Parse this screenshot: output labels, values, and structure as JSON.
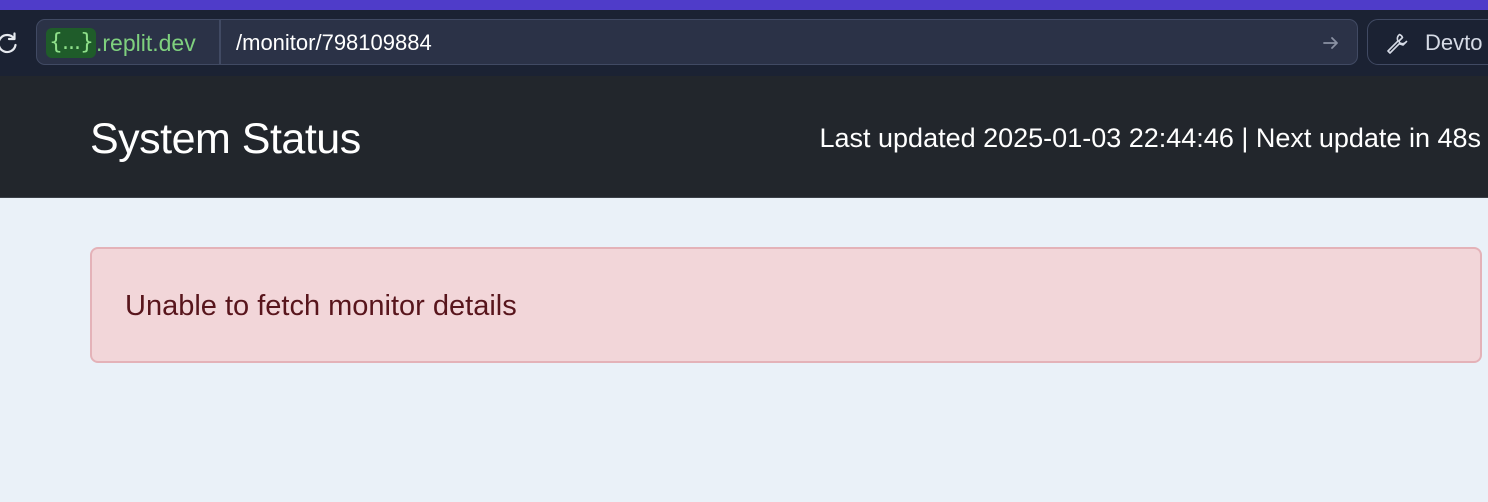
{
  "browser": {
    "domain_badge": "{...}",
    "domain": ".replit.dev",
    "path": "/monitor/798109884",
    "devtools_label": "Devto",
    "icons": {
      "reload": "reload-icon",
      "go": "arrow-right-icon",
      "devtools": "wrench-icon"
    },
    "accent_color": "#4f3cc9"
  },
  "header": {
    "title": "System Status",
    "status": "Last updated 2025-01-03 22:44:46 | Next update in 48s"
  },
  "alert": {
    "message": "Unable to fetch monitor details",
    "background_color": "#f2d6d9",
    "text_color": "#58151c"
  }
}
